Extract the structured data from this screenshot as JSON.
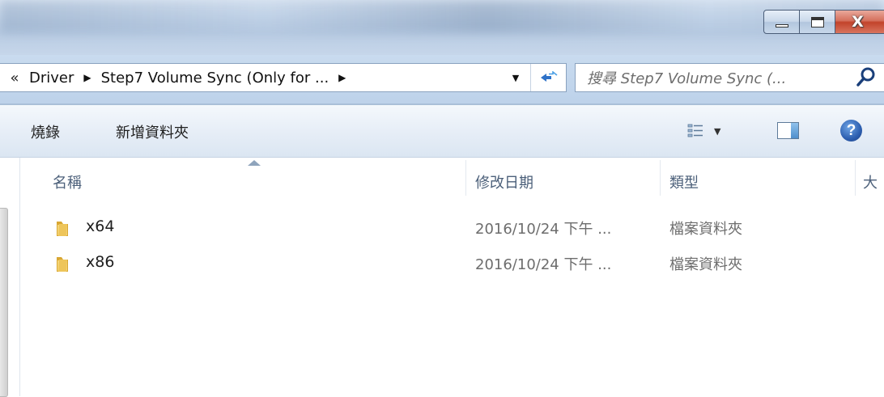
{
  "window": {
    "controls": {
      "minimize": "minimize",
      "maximize": "maximize",
      "close_glyph": "X"
    }
  },
  "address_bar": {
    "overflow_glyph": "«",
    "breadcrumbs": [
      {
        "label": "Driver"
      },
      {
        "label": "Step7  Volume Sync (Only for ..."
      }
    ],
    "separator_glyph": "▶",
    "dropdown_glyph": "▼",
    "refresh_glyph": "↤↦"
  },
  "search": {
    "placeholder": "搜尋 Step7  Volume Sync (..."
  },
  "toolbar": {
    "burn_label": "燒錄",
    "new_folder_label": "新增資料夾",
    "views_dropdown_glyph": "▼",
    "help_glyph": "?"
  },
  "columns": {
    "name": "名稱",
    "modified": "修改日期",
    "type": "類型",
    "size": "大"
  },
  "files": [
    {
      "name": "x64",
      "modified": "2016/10/24 下午 ...",
      "type": "檔案資料夾"
    },
    {
      "name": "x86",
      "modified": "2016/10/24 下午 ...",
      "type": "檔案資料夾"
    }
  ],
  "colors": {
    "folder": "#e8c25a",
    "header_text": "#4c607a",
    "accent_blue": "#2e72c8",
    "close_red": "#c2432b"
  }
}
